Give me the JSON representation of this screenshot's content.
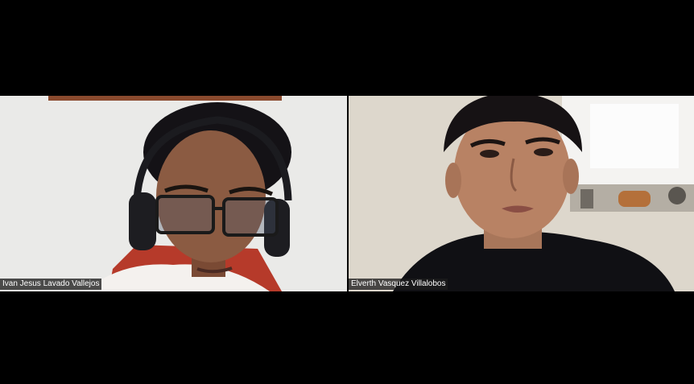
{
  "participants": [
    {
      "name": "Ivan Jesus Lavado Vallejos"
    },
    {
      "name": "Elverth Vasquez Villalobos"
    }
  ],
  "colors": {
    "stage_background": "#000000",
    "name_tag_background": "#1c1c1c",
    "name_tag_text": "#ffffff"
  }
}
